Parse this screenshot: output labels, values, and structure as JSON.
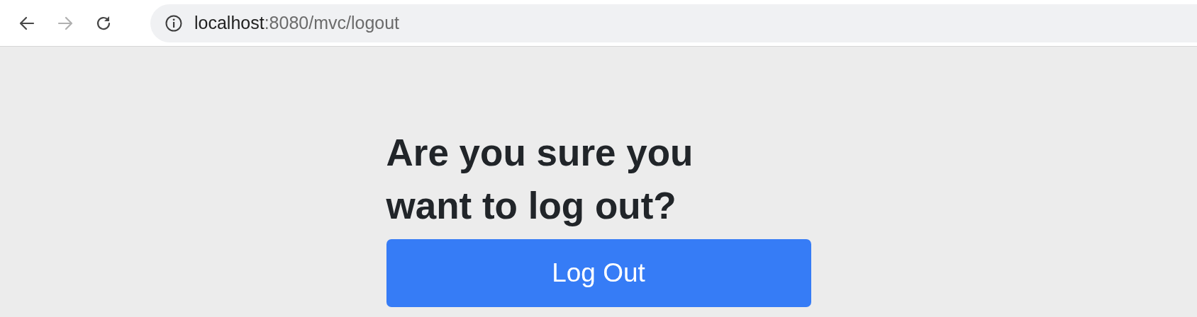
{
  "toolbar": {
    "nav_buttons": [
      {
        "kind": "back",
        "disabled": false
      },
      {
        "kind": "forward",
        "disabled": true
      },
      {
        "kind": "reload",
        "disabled": false
      }
    ],
    "address": {
      "host": "localhost",
      "path": ":8080/mvc/logout"
    }
  },
  "page": {
    "heading": "Are you sure you want to log out?",
    "button": "Log Out"
  }
}
